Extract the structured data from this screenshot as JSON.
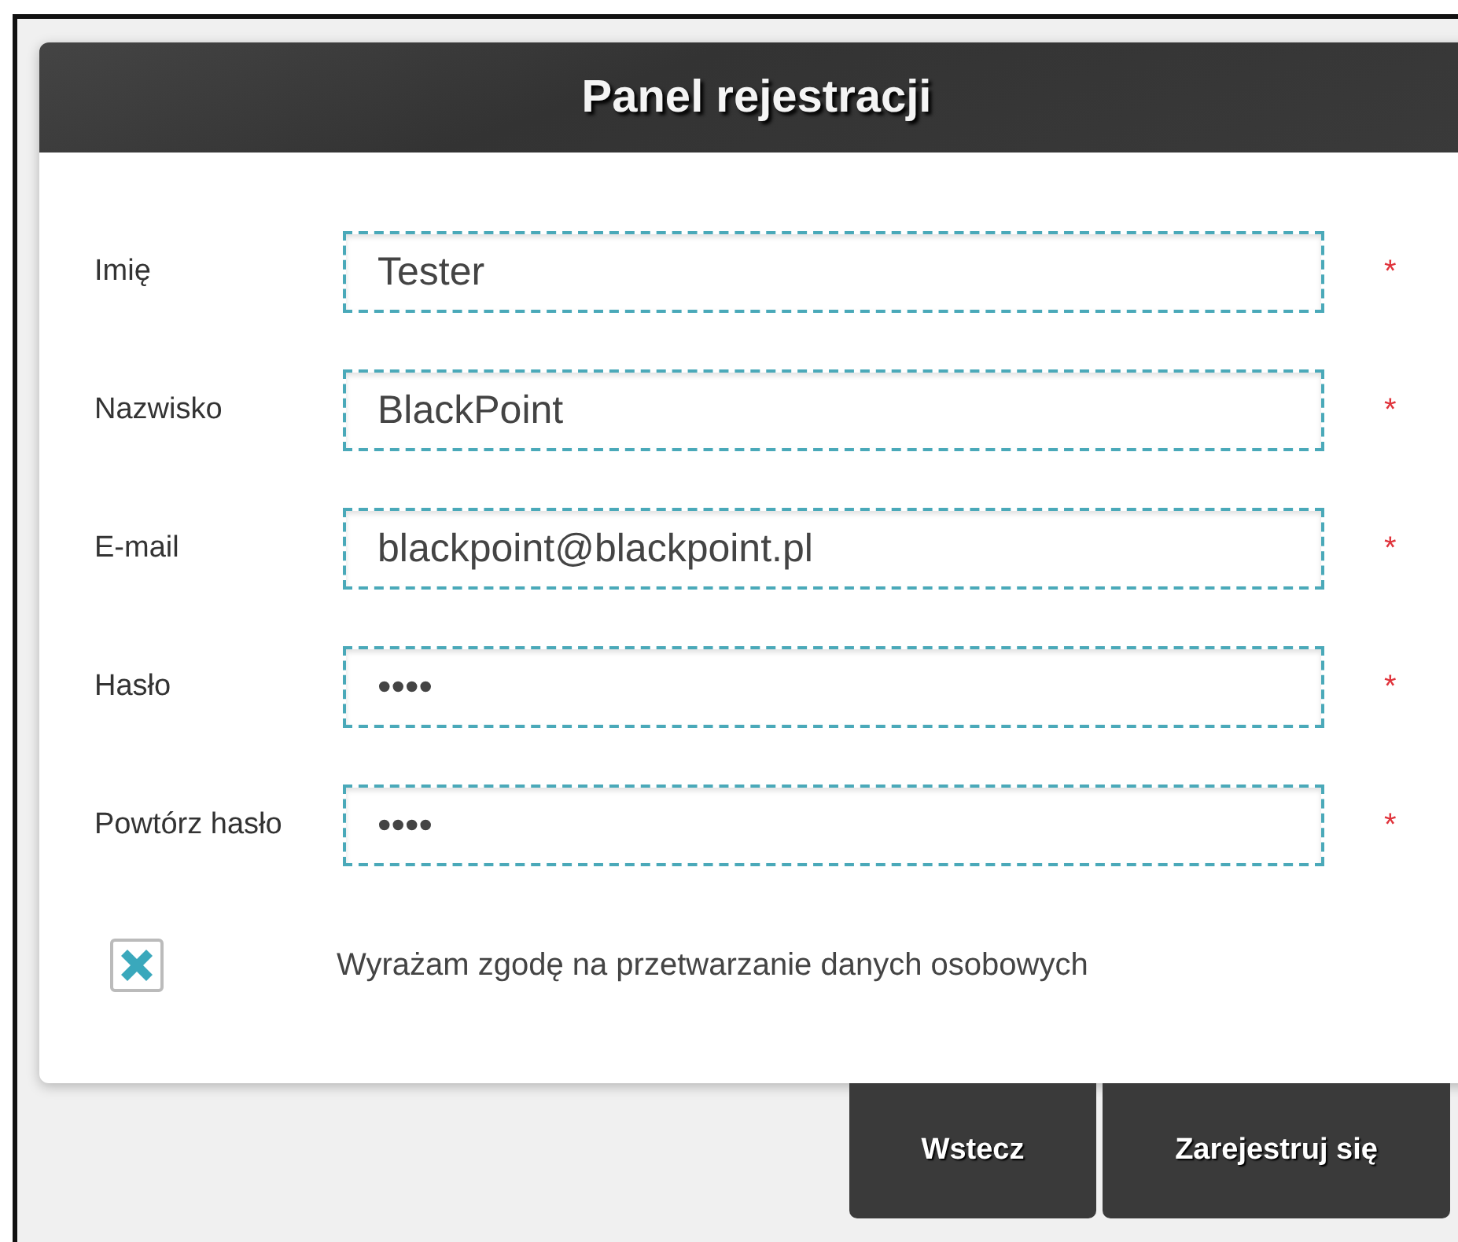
{
  "panel": {
    "title": "Panel rejestracji"
  },
  "fields": [
    {
      "label": "Imię",
      "value": "Tester",
      "required_mark": "*"
    },
    {
      "label": "Nazwisko",
      "value": "BlackPoint",
      "required_mark": "*"
    },
    {
      "label": "E-mail",
      "value": "blackpoint@blackpoint.pl",
      "required_mark": "*"
    },
    {
      "label": "Hasło",
      "value": "••••",
      "required_mark": "*"
    },
    {
      "label": "Powtórz hasło",
      "value": "••••",
      "required_mark": "*"
    }
  ],
  "consent": {
    "label": "Wyrażam zgodę na przetwarzanie danych osobowych",
    "checked": true
  },
  "buttons": [
    "Wstecz",
    "Zarejestruj się"
  ]
}
